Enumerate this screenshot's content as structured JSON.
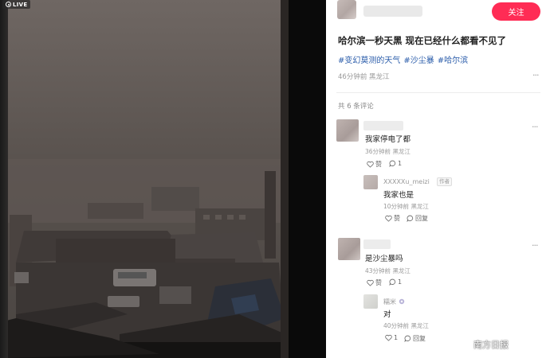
{
  "photo": {
    "live_label": "LIVE"
  },
  "post": {
    "follow_label": "关注",
    "title": "哈尔滨一秒天黑 现在已经什么都看不见了",
    "hashtags": [
      "#变幻莫测的天气",
      "#沙尘暴",
      "#哈尔滨"
    ],
    "time": "46分钟前",
    "location": "黑龙江",
    "comment_count": "共 6 条评论"
  },
  "comments": [
    {
      "text": "我家停电了都",
      "time": "36分钟前",
      "location": "黑龙江",
      "like_label": "赞",
      "reply_count": "1",
      "replies": [
        {
          "name": "XXXXXu_meizi",
          "tag": "作者",
          "text": "我家也是",
          "time": "10分钟前",
          "location": "黑龙江",
          "like_label": "赞",
          "reply_label": "回复"
        }
      ]
    },
    {
      "text": "是沙尘暴吗",
      "time": "43分钟前",
      "location": "黑龙江",
      "like_label": "赞",
      "reply_count": "1",
      "replies": [
        {
          "name": "糯米",
          "text": "对",
          "time": "40分钟前",
          "location": "黑龙江",
          "like_count": "1",
          "reply_label": "回复"
        }
      ]
    }
  ],
  "watermark": "南方日报",
  "colors": {
    "accent": "#ff2c55",
    "hashtag": "#2a5caa",
    "meta": "#999999"
  }
}
